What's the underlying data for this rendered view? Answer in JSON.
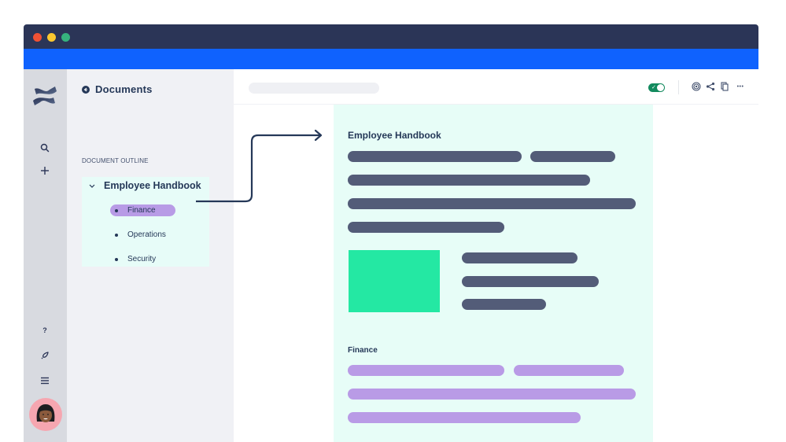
{
  "window": {
    "controls": [
      "close",
      "minimize",
      "maximize"
    ],
    "colors": {
      "titlebar": "#2b3557",
      "accent_bar": "#0f62fe",
      "close": "#ef5134",
      "minimize": "#fbc82f",
      "maximize": "#36b37e"
    }
  },
  "rail": {
    "logo": "confluence-logo",
    "top_icons": [
      "search-icon",
      "plus-icon"
    ],
    "bottom_icons": [
      "help-icon",
      "rocket-icon",
      "menu-icon"
    ],
    "help_glyph": "?",
    "avatar": "user-avatar"
  },
  "sidebar": {
    "back_label": "Documents",
    "outline_heading": "DOCUMENT OUTLINE",
    "tree": {
      "root": "Employee Handbook",
      "expanded": true,
      "children": [
        {
          "label": "Finance",
          "active": true
        },
        {
          "label": "Operations",
          "active": false
        },
        {
          "label": "Security",
          "active": false
        }
      ]
    }
  },
  "topbar": {
    "search_placeholder": "",
    "toggle_on": true,
    "toggle_check": "✓",
    "actions": [
      "watch-icon",
      "share-icon",
      "copy-icon",
      "more-icon"
    ],
    "more_glyph": "•••"
  },
  "document": {
    "title": "Employee Handbook",
    "section_title": "Finance",
    "colors": {
      "background": "#e7fdf7",
      "text_placeholder": "#535c78",
      "highlight_placeholder": "#b99be6",
      "image": "#24e8a3"
    }
  }
}
